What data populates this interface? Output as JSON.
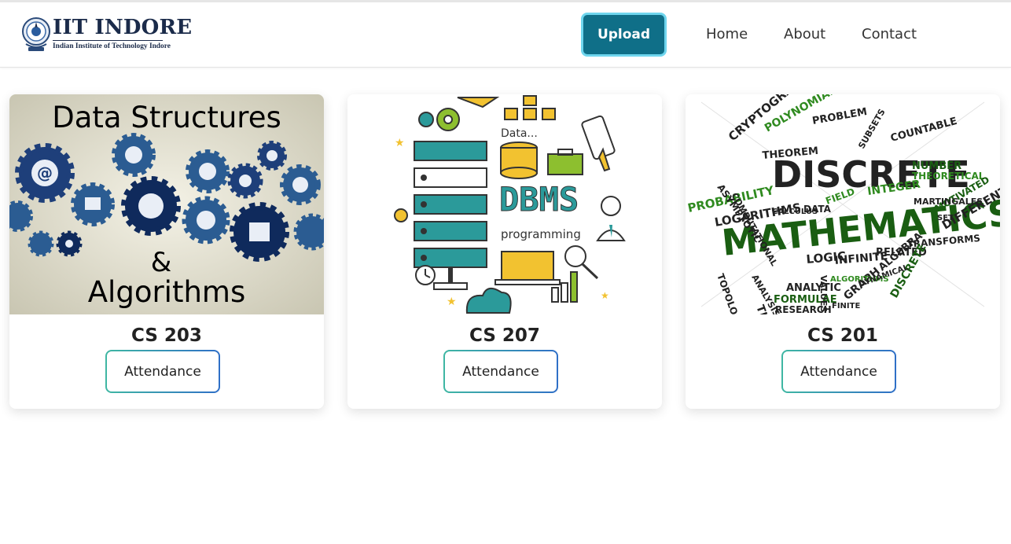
{
  "brand": {
    "title": "IIT INDORE",
    "subtitle": "Indian Institute of Technology Indore"
  },
  "nav": {
    "upload_label": "Upload",
    "links": [
      "Home",
      "About",
      "Contact"
    ]
  },
  "colors": {
    "accent": "#0f6f88",
    "accent_border": "#6fd6ee",
    "gradient_start": "#3fb7a3",
    "gradient_end": "#2f6fc7"
  },
  "courses": [
    {
      "code": "CS 203",
      "button_label": "Attendance",
      "image": {
        "kind": "gears-illustration",
        "line1": "Data Structures",
        "line2": "&",
        "line3": "Algorithms"
      }
    },
    {
      "code": "CS 207",
      "button_label": "Attendance",
      "image": {
        "kind": "database-illustration",
        "label_data": "Data...",
        "label_dbms": "DBMS",
        "label_prog": "programming"
      }
    },
    {
      "code": "CS 201",
      "button_label": "Attendance",
      "image": {
        "kind": "word-cloud",
        "words": [
          "DISCRETE",
          "MATHEMATICS",
          "PROBABILITY",
          "LOGARITHMS",
          "CRYPTOGRAPHY",
          "POLYNOMIALS",
          "THEOREM",
          "NUMBER",
          "THEORETICAL",
          "DIFFERENTIAL",
          "MOTIVATED",
          "INTEGER",
          "COUNTABLE",
          "SUBSETS",
          "PROBLEM",
          "TOPOLOGY",
          "ANALYTIC",
          "LOGIC",
          "INFINITE",
          "RELATED",
          "TRANSFORMS",
          "ALGEBRA",
          "GRAPH",
          "DISCRETE",
          "THEORY",
          "FORMULAE",
          "RESEARCH",
          "FINITE",
          "SET",
          "FIELD",
          "ASYMPTOTIC",
          "COMPUTATIONAL",
          "DATA",
          "CALCULUS",
          "MARTINGALES",
          "ALGORITHMS",
          "DYNAMICAL",
          "ANALYSIS",
          "VALUES"
        ]
      }
    }
  ]
}
